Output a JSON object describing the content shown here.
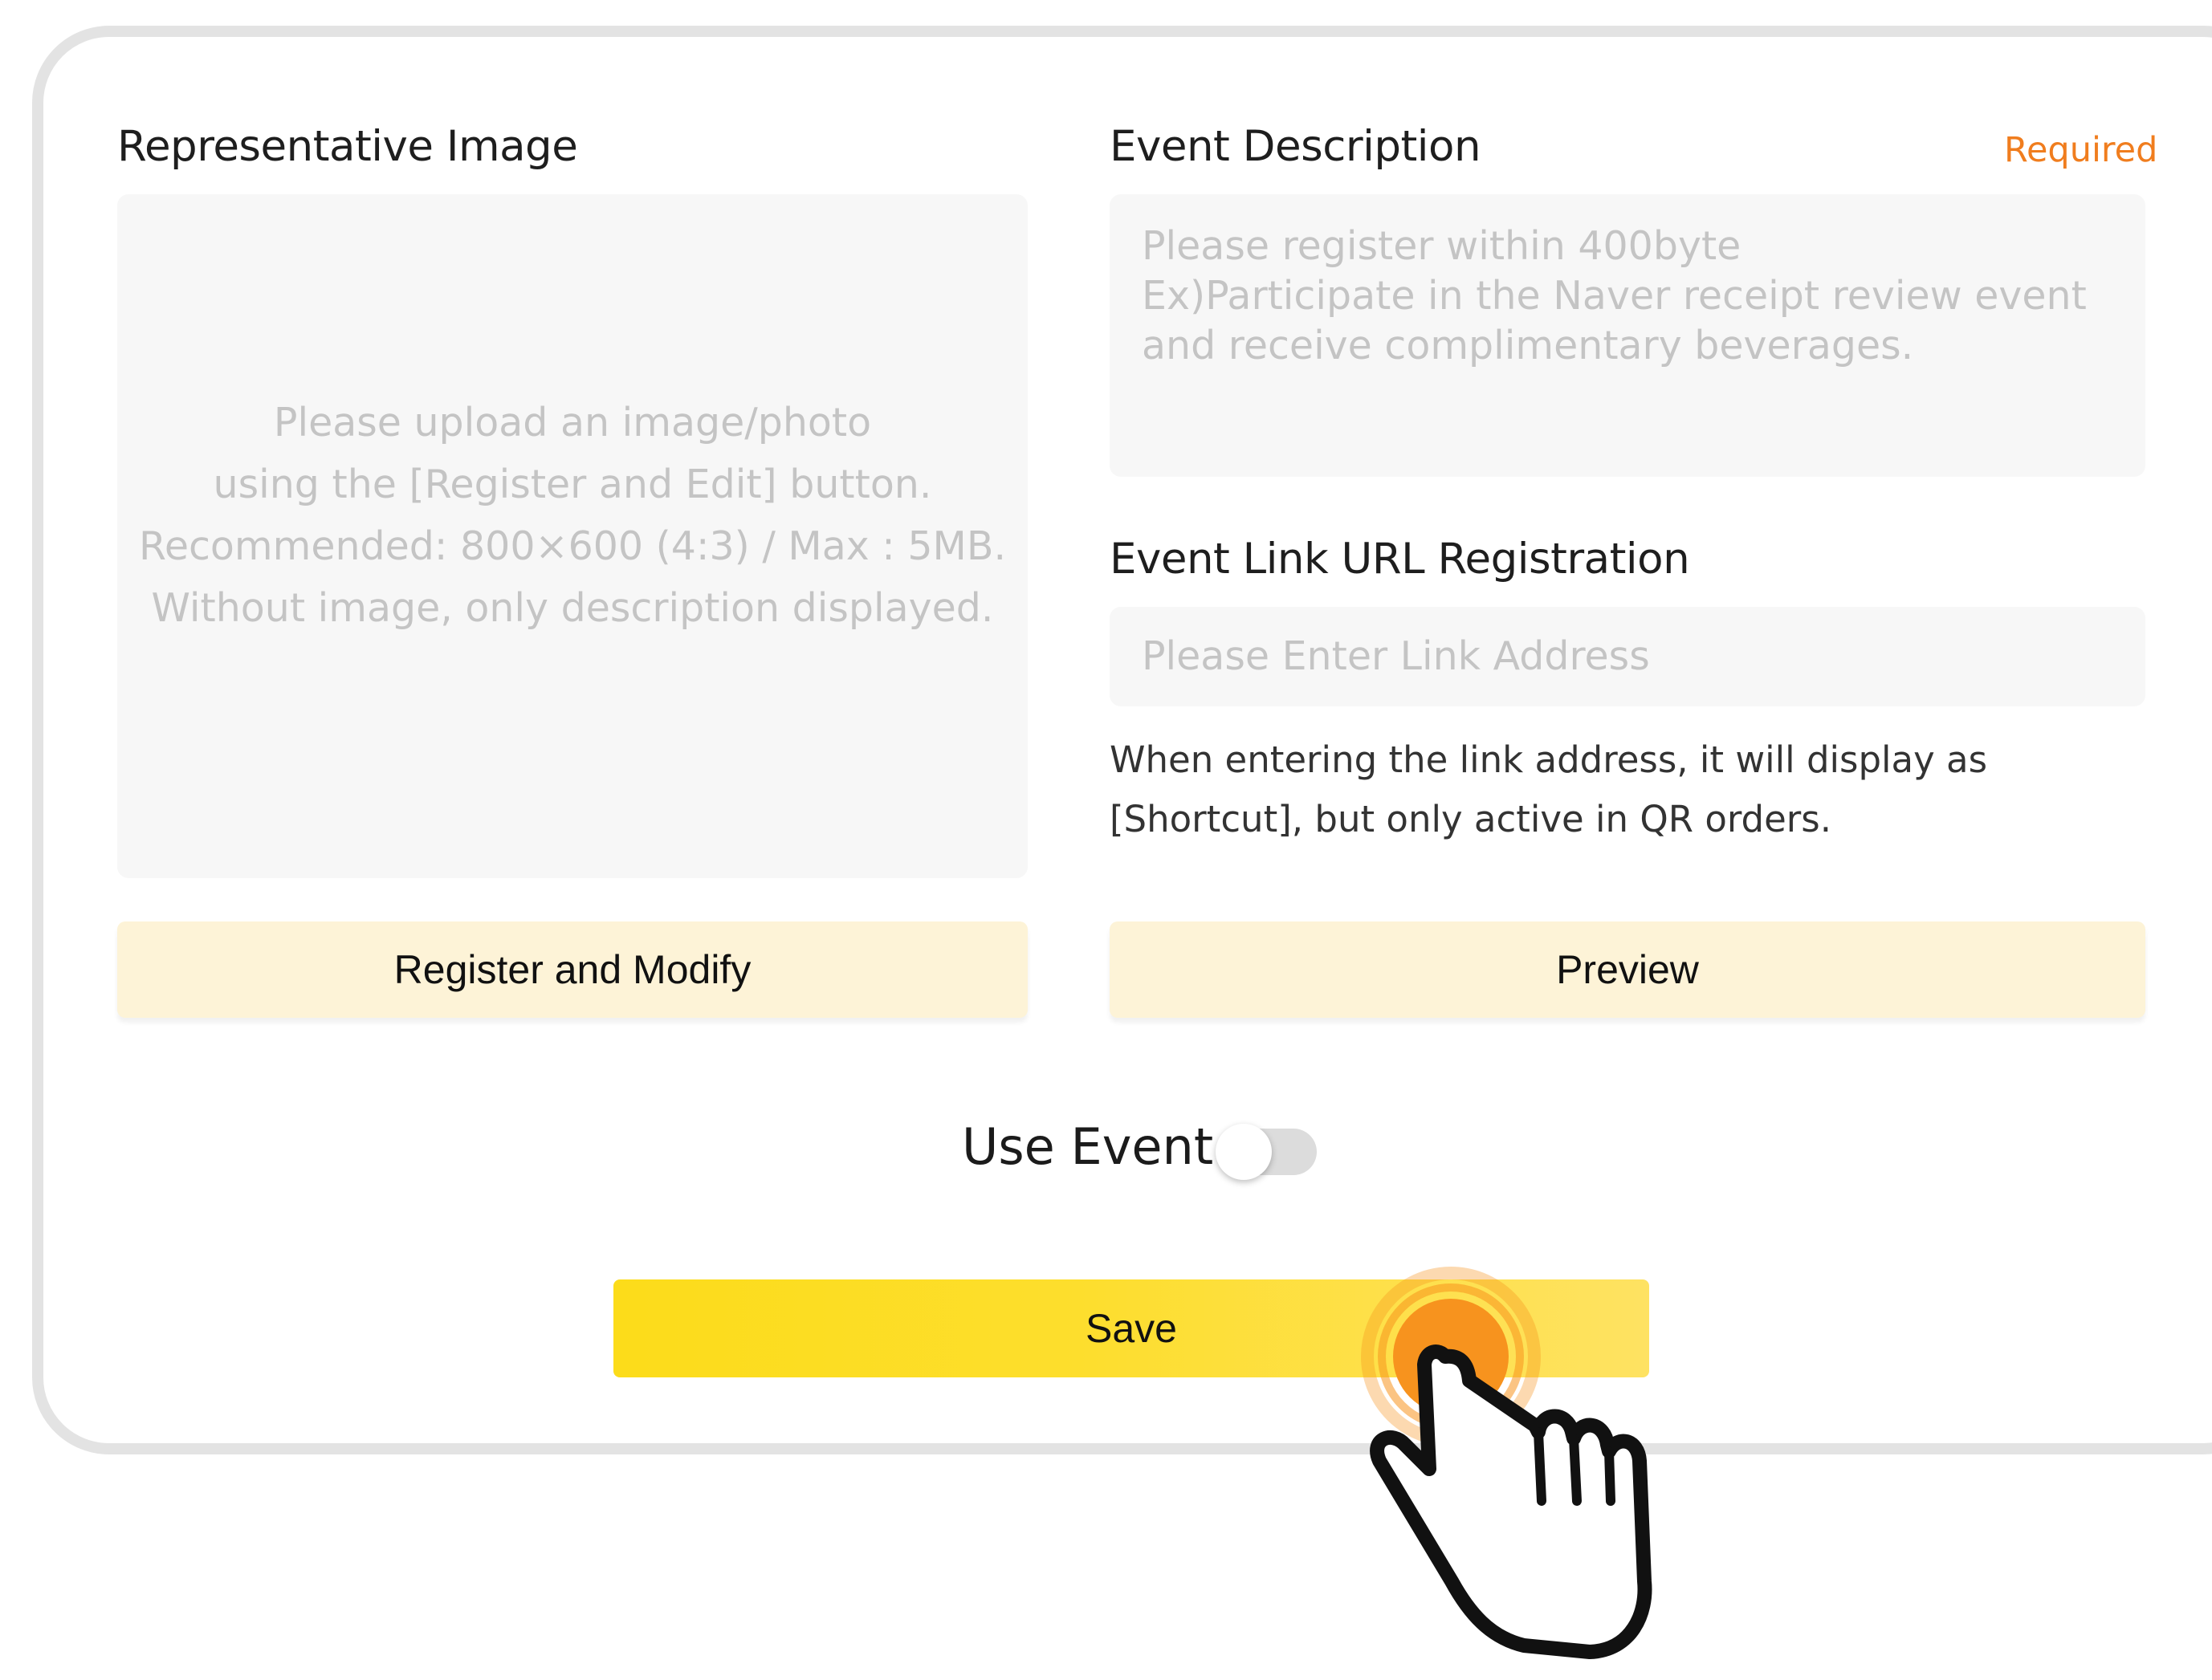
{
  "representative_image": {
    "label": "Representative Image",
    "hint_lines": [
      "Please upload an image/photo",
      "using the [Register and Edit] button.",
      "Recommended: 800×600 (4:3) / Max : 5MB.",
      "Without image, only description displayed."
    ],
    "button_label": "Register and Modify"
  },
  "event_description": {
    "label": "Event Description",
    "required_label": "Required",
    "placeholder_lines": [
      "Please register within 400byte",
      "Ex)Participate in the Naver receipt review event",
      "and receive complimentary beverages."
    ]
  },
  "event_link": {
    "label": "Event Link URL Registration",
    "placeholder": "Please Enter Link Address",
    "note_lines": [
      "When entering the link address, it will display as",
      "[Shortcut], but only active in QR orders."
    ],
    "preview_label": "Preview"
  },
  "use_event": {
    "label": "Use Event",
    "enabled": false
  },
  "save_label": "Save",
  "colors": {
    "required": "#f07d1e",
    "soft_button": "#fdf3d7",
    "save_button": "#fcdc1a",
    "click_highlight": "#f7931e"
  },
  "icons": {
    "cursor": "hand-pointer-icon"
  }
}
